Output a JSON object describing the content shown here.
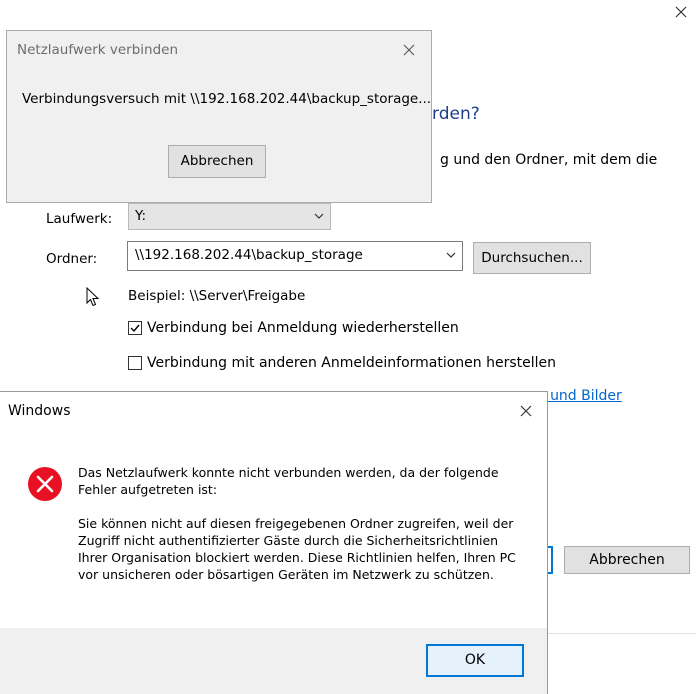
{
  "wizard": {
    "heading": "rden?",
    "description": "g und den Ordner, mit dem die",
    "drive_label": "Laufwerk:",
    "drive_value": "Y:",
    "folder_label": "Ordner:",
    "folder_value": "\\\\192.168.202.44\\backup_storage",
    "browse_label": "Durchsuchen...",
    "example": "Beispiel: \\\\Server\\Freigabe",
    "reconnect_label": "Verbindung bei Anmeldung wiederherstellen",
    "reconnect_checked": true,
    "other_creds_label": "Verbindung mit anderen Anmeldeinformationen herstellen",
    "other_creds_checked": false,
    "link_text": "e und Bilder",
    "cancel_label": "Abbrechen"
  },
  "connect_dialog": {
    "title": "Netzlaufwerk verbinden",
    "message": "Verbindungsversuch mit \\\\192.168.202.44\\backup_storage...",
    "cancel_label": "Abbrechen"
  },
  "error_dialog": {
    "title": "Windows",
    "message_1": "Das Netzlaufwerk konnte nicht verbunden werden, da der folgende\nFehler aufgetreten ist:",
    "message_2": "Sie können nicht auf diesen freigegebenen Ordner zugreifen, weil der\nZugriff nicht authentifizierter Gäste durch die Sicherheitsrichtlinien\nIhrer Organisation blockiert werden. Diese Richtlinien helfen, Ihren PC\nvor unsicheren oder bösartigen Geräten im Netzwerk zu schützen.",
    "ok_label": "OK",
    "icon": "error-icon"
  },
  "colors": {
    "accent": "#0078d7",
    "error": "#e81123",
    "link": "#0066cc",
    "heading": "#1e3d8c"
  }
}
